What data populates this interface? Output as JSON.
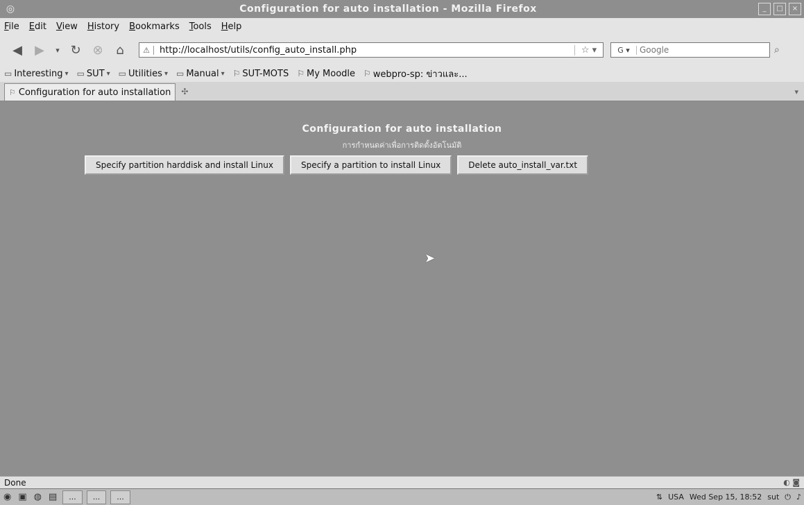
{
  "window": {
    "title": "Configuration for auto installation - Mozilla Firefox"
  },
  "menubar": {
    "items": [
      "File",
      "Edit",
      "View",
      "History",
      "Bookmarks",
      "Tools",
      "Help"
    ]
  },
  "navigation": {
    "url": "http://localhost/utils/config_auto_install.php",
    "search_placeholder": "Google"
  },
  "bookmarks": {
    "items": [
      {
        "label": "Interesting",
        "icon": "folder-icon",
        "dropdown": true
      },
      {
        "label": "SUT",
        "icon": "folder-icon",
        "dropdown": true
      },
      {
        "label": "Utilities",
        "icon": "folder-icon",
        "dropdown": true
      },
      {
        "label": "Manual",
        "icon": "folder-icon",
        "dropdown": true
      },
      {
        "label": "SUT-MOTS",
        "icon": "page-icon",
        "dropdown": false
      },
      {
        "label": "My Moodle",
        "icon": "page-icon",
        "dropdown": false
      },
      {
        "label": "webpro-sp: ข่าวและ...",
        "icon": "page-icon",
        "dropdown": false
      }
    ]
  },
  "tabs": [
    {
      "label": "Configuration for auto installation"
    }
  ],
  "page": {
    "title": "Configuration for auto installation",
    "subtitle": "การกำหนดค่าเพื่อการติดตั้งอัตโนมัติ",
    "buttons": [
      "Specify partition harddisk and install Linux",
      "Specify a partition to install Linux",
      "Delete auto_install_var.txt"
    ]
  },
  "statusbar": {
    "text": "Done"
  },
  "taskbar": {
    "tasks": [
      "...",
      "...",
      "..."
    ],
    "layout": "USA",
    "clock": "Wed Sep 15, 18:52",
    "user": "sut"
  }
}
